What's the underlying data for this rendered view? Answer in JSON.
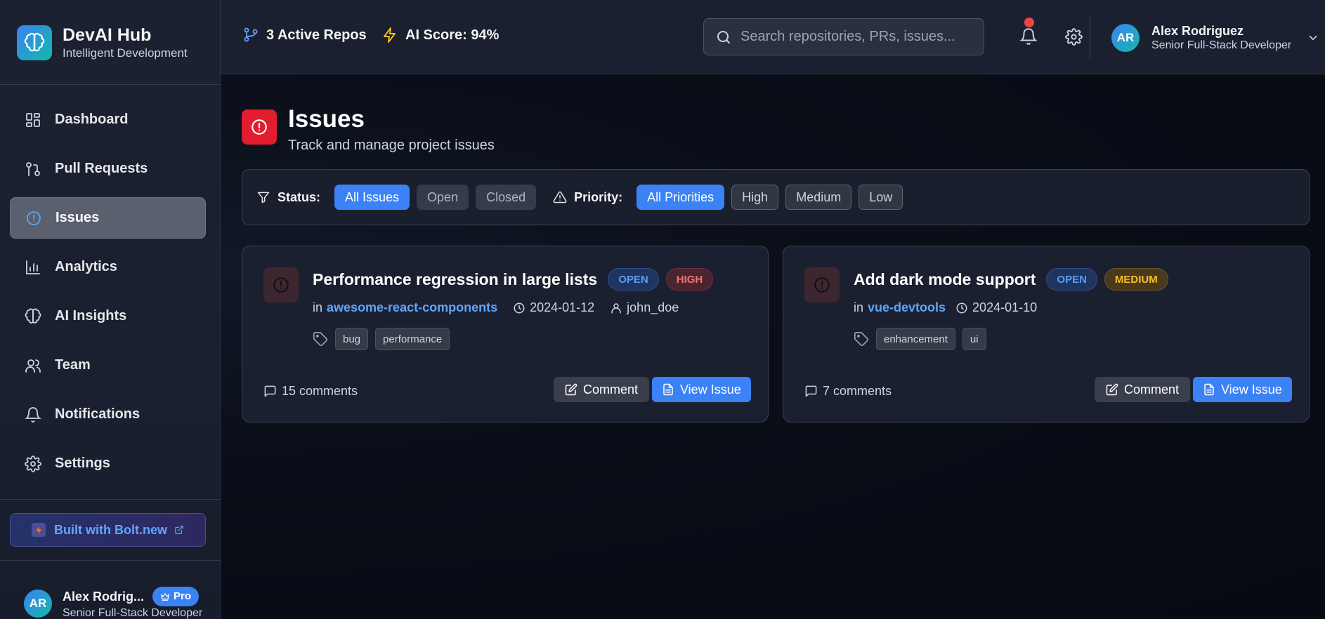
{
  "brand": {
    "title": "DevAI Hub",
    "subtitle": "Intelligent Development"
  },
  "sidebar": {
    "items": [
      {
        "label": "Dashboard",
        "icon": "dashboard-icon"
      },
      {
        "label": "Pull Requests",
        "icon": "git-pull-request-icon"
      },
      {
        "label": "Issues",
        "icon": "alert-circle-icon",
        "active": true
      },
      {
        "label": "Analytics",
        "icon": "bar-chart-icon"
      },
      {
        "label": "AI Insights",
        "icon": "brain-icon"
      },
      {
        "label": "Team",
        "icon": "users-icon"
      },
      {
        "label": "Notifications",
        "icon": "bell-icon"
      },
      {
        "label": "Settings",
        "icon": "gear-icon"
      }
    ],
    "bolt_label": "Built with Bolt.new",
    "user": {
      "initials": "AR",
      "name": "Alex Rodrig...",
      "role": "Senior Full-Stack Developer",
      "badge": "Pro"
    }
  },
  "topbar": {
    "repos": "3 Active Repos",
    "ai_score": "AI Score: 94%",
    "search_placeholder": "Search repositories, PRs, issues...",
    "user": {
      "initials": "AR",
      "name": "Alex Rodriguez",
      "role": "Senior Full-Stack Developer"
    }
  },
  "page": {
    "title": "Issues",
    "subtitle": "Track and manage project issues"
  },
  "filters": {
    "status_label": "Status:",
    "status_options": [
      "All Issues",
      "Open",
      "Closed"
    ],
    "priority_label": "Priority:",
    "priority_options": [
      "All Priorities",
      "High",
      "Medium",
      "Low"
    ]
  },
  "issues": [
    {
      "title": "Performance regression in large lists",
      "status": "OPEN",
      "priority": "HIGH",
      "in": "in",
      "repo": "awesome-react-components",
      "date": "2024-01-12",
      "author": "john_doe",
      "tags": [
        "bug",
        "performance"
      ],
      "comments": "15 comments",
      "comment_label": "Comment",
      "view_label": "View Issue"
    },
    {
      "title": "Add dark mode support",
      "status": "OPEN",
      "priority": "MEDIUM",
      "in": "in",
      "repo": "vue-devtools",
      "date": "2024-01-10",
      "tags": [
        "enhancement",
        "ui"
      ],
      "comments": "7 comments",
      "comment_label": "Comment",
      "view_label": "View Issue"
    }
  ],
  "colors": {
    "accent": "#3b82f6",
    "danger": "#e11d2f",
    "warning": "#fbbf24",
    "link": "#60a5fa"
  }
}
